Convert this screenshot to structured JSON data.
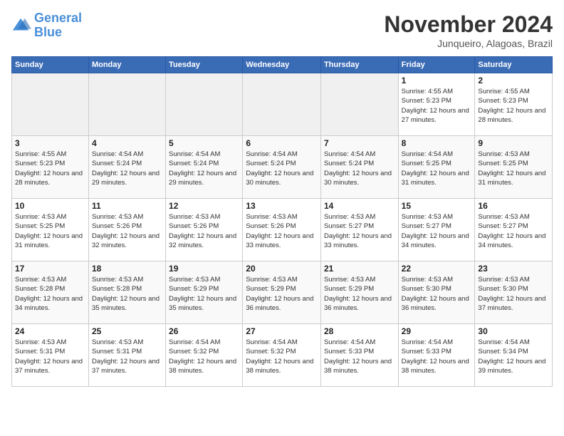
{
  "logo": {
    "line1": "General",
    "line2": "Blue"
  },
  "title": "November 2024",
  "subtitle": "Junqueiro, Alagoas, Brazil",
  "days_of_week": [
    "Sunday",
    "Monday",
    "Tuesday",
    "Wednesday",
    "Thursday",
    "Friday",
    "Saturday"
  ],
  "weeks": [
    [
      {
        "day": "",
        "info": ""
      },
      {
        "day": "",
        "info": ""
      },
      {
        "day": "",
        "info": ""
      },
      {
        "day": "",
        "info": ""
      },
      {
        "day": "",
        "info": ""
      },
      {
        "day": "1",
        "info": "Sunrise: 4:55 AM\nSunset: 5:23 PM\nDaylight: 12 hours and 27 minutes."
      },
      {
        "day": "2",
        "info": "Sunrise: 4:55 AM\nSunset: 5:23 PM\nDaylight: 12 hours and 28 minutes."
      }
    ],
    [
      {
        "day": "3",
        "info": "Sunrise: 4:55 AM\nSunset: 5:23 PM\nDaylight: 12 hours and 28 minutes."
      },
      {
        "day": "4",
        "info": "Sunrise: 4:54 AM\nSunset: 5:24 PM\nDaylight: 12 hours and 29 minutes."
      },
      {
        "day": "5",
        "info": "Sunrise: 4:54 AM\nSunset: 5:24 PM\nDaylight: 12 hours and 29 minutes."
      },
      {
        "day": "6",
        "info": "Sunrise: 4:54 AM\nSunset: 5:24 PM\nDaylight: 12 hours and 30 minutes."
      },
      {
        "day": "7",
        "info": "Sunrise: 4:54 AM\nSunset: 5:24 PM\nDaylight: 12 hours and 30 minutes."
      },
      {
        "day": "8",
        "info": "Sunrise: 4:54 AM\nSunset: 5:25 PM\nDaylight: 12 hours and 31 minutes."
      },
      {
        "day": "9",
        "info": "Sunrise: 4:53 AM\nSunset: 5:25 PM\nDaylight: 12 hours and 31 minutes."
      }
    ],
    [
      {
        "day": "10",
        "info": "Sunrise: 4:53 AM\nSunset: 5:25 PM\nDaylight: 12 hours and 31 minutes."
      },
      {
        "day": "11",
        "info": "Sunrise: 4:53 AM\nSunset: 5:26 PM\nDaylight: 12 hours and 32 minutes."
      },
      {
        "day": "12",
        "info": "Sunrise: 4:53 AM\nSunset: 5:26 PM\nDaylight: 12 hours and 32 minutes."
      },
      {
        "day": "13",
        "info": "Sunrise: 4:53 AM\nSunset: 5:26 PM\nDaylight: 12 hours and 33 minutes."
      },
      {
        "day": "14",
        "info": "Sunrise: 4:53 AM\nSunset: 5:27 PM\nDaylight: 12 hours and 33 minutes."
      },
      {
        "day": "15",
        "info": "Sunrise: 4:53 AM\nSunset: 5:27 PM\nDaylight: 12 hours and 34 minutes."
      },
      {
        "day": "16",
        "info": "Sunrise: 4:53 AM\nSunset: 5:27 PM\nDaylight: 12 hours and 34 minutes."
      }
    ],
    [
      {
        "day": "17",
        "info": "Sunrise: 4:53 AM\nSunset: 5:28 PM\nDaylight: 12 hours and 34 minutes."
      },
      {
        "day": "18",
        "info": "Sunrise: 4:53 AM\nSunset: 5:28 PM\nDaylight: 12 hours and 35 minutes."
      },
      {
        "day": "19",
        "info": "Sunrise: 4:53 AM\nSunset: 5:29 PM\nDaylight: 12 hours and 35 minutes."
      },
      {
        "day": "20",
        "info": "Sunrise: 4:53 AM\nSunset: 5:29 PM\nDaylight: 12 hours and 36 minutes."
      },
      {
        "day": "21",
        "info": "Sunrise: 4:53 AM\nSunset: 5:29 PM\nDaylight: 12 hours and 36 minutes."
      },
      {
        "day": "22",
        "info": "Sunrise: 4:53 AM\nSunset: 5:30 PM\nDaylight: 12 hours and 36 minutes."
      },
      {
        "day": "23",
        "info": "Sunrise: 4:53 AM\nSunset: 5:30 PM\nDaylight: 12 hours and 37 minutes."
      }
    ],
    [
      {
        "day": "24",
        "info": "Sunrise: 4:53 AM\nSunset: 5:31 PM\nDaylight: 12 hours and 37 minutes."
      },
      {
        "day": "25",
        "info": "Sunrise: 4:53 AM\nSunset: 5:31 PM\nDaylight: 12 hours and 37 minutes."
      },
      {
        "day": "26",
        "info": "Sunrise: 4:54 AM\nSunset: 5:32 PM\nDaylight: 12 hours and 38 minutes."
      },
      {
        "day": "27",
        "info": "Sunrise: 4:54 AM\nSunset: 5:32 PM\nDaylight: 12 hours and 38 minutes."
      },
      {
        "day": "28",
        "info": "Sunrise: 4:54 AM\nSunset: 5:33 PM\nDaylight: 12 hours and 38 minutes."
      },
      {
        "day": "29",
        "info": "Sunrise: 4:54 AM\nSunset: 5:33 PM\nDaylight: 12 hours and 38 minutes."
      },
      {
        "day": "30",
        "info": "Sunrise: 4:54 AM\nSunset: 5:34 PM\nDaylight: 12 hours and 39 minutes."
      }
    ]
  ]
}
